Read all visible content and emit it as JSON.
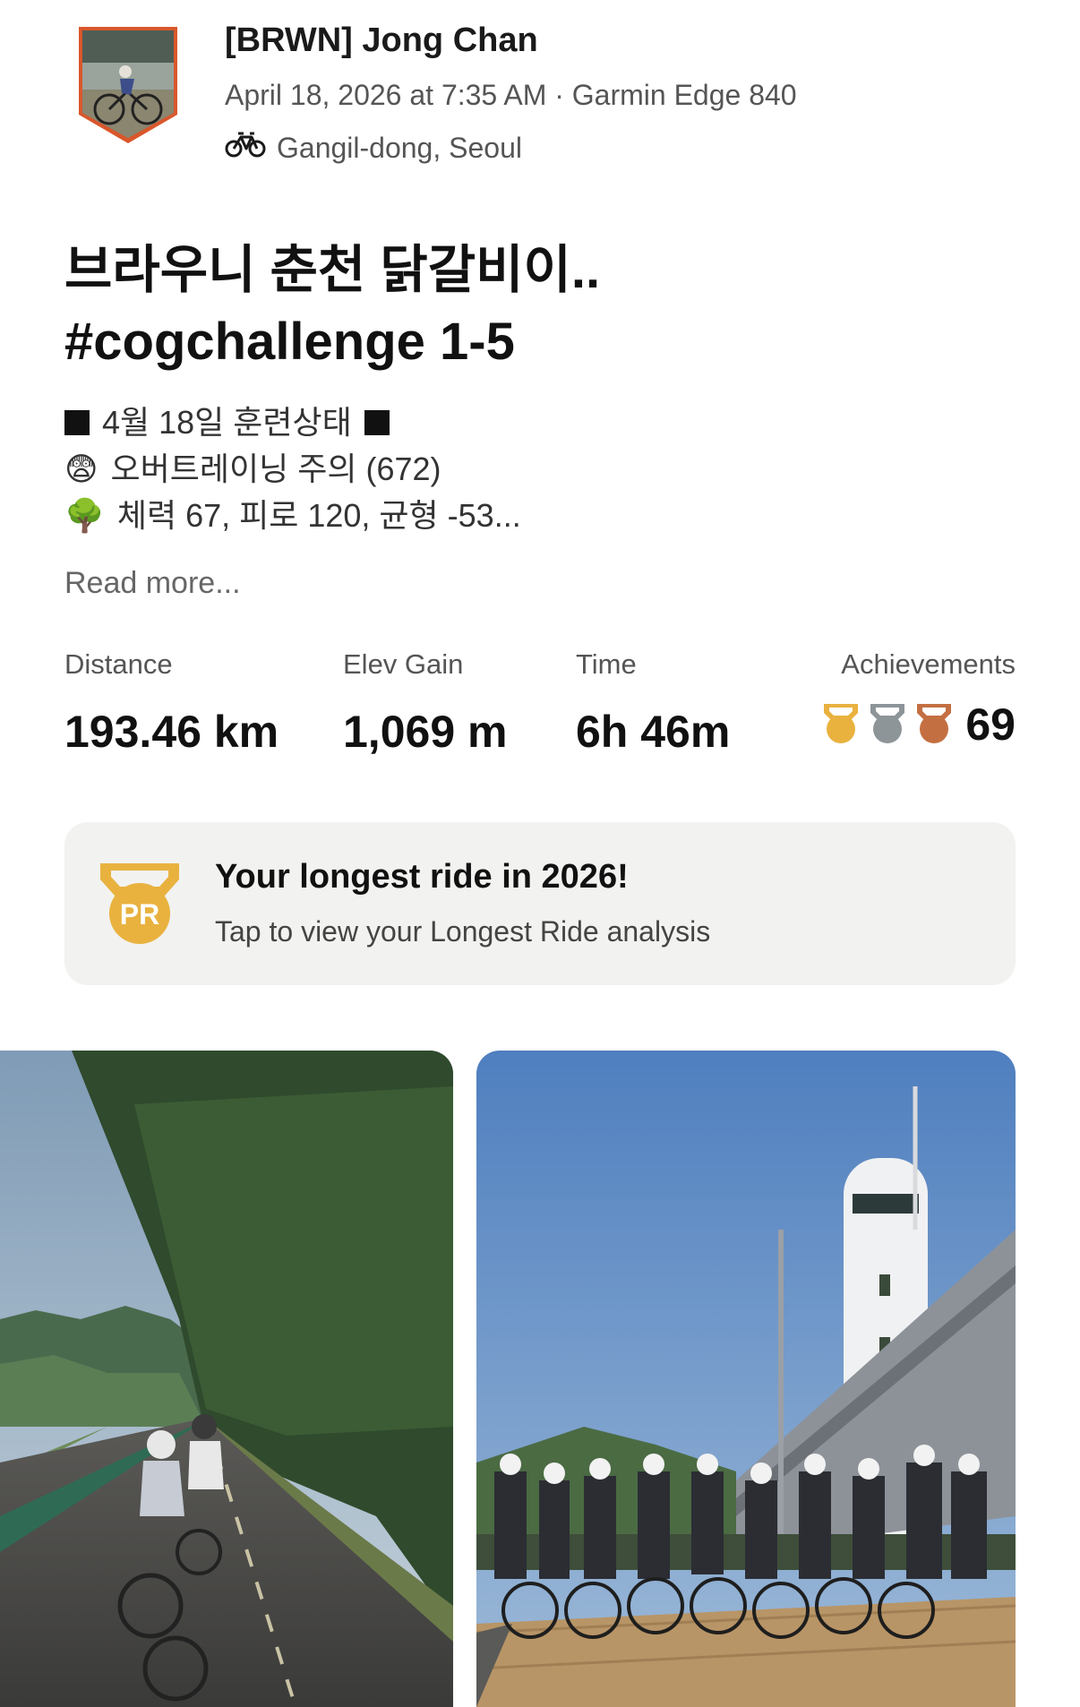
{
  "activity": {
    "athlete_name": "[BRWN] Jong Chan",
    "datetime": "April 18, 2026 at 7:35 AM",
    "device": "Garmin Edge 840",
    "separator": "·",
    "location": "Gangil-dong, Seoul",
    "title_line1": "브라우니 춘천 닭갈비이..",
    "title_line2": "#cogchallenge 1-5"
  },
  "description": {
    "line1": "4월 18일 훈련상태",
    "line2": "오버트레이닝 주의 (672)",
    "line3": "체력 67, 피로 120, 균형 -53...",
    "emoji2": "😨",
    "emoji3": "🌳",
    "read_more": "Read more..."
  },
  "stats": {
    "distance_label": "Distance",
    "distance_value": "193.46 km",
    "elev_label": "Elev Gain",
    "elev_value": "1,069 m",
    "time_label": "Time",
    "time_value": "6h 46m",
    "achievements_label": "Achievements",
    "achievements_count": "69"
  },
  "pr_card": {
    "badge_text": "PR",
    "title": "Your longest ride in 2026!",
    "subtitle": "Tap to view your Longest Ride analysis"
  },
  "colors": {
    "gold": "#e9b23f",
    "silver": "#8d9599",
    "bronze": "#c46f42",
    "avatar_border": "#d9572b"
  },
  "icons": {
    "bike": "bike-icon",
    "pr": "pr-medal-icon",
    "gold": "gold-trophy-icon",
    "silver": "silver-trophy-icon",
    "bronze": "bronze-trophy-icon"
  }
}
